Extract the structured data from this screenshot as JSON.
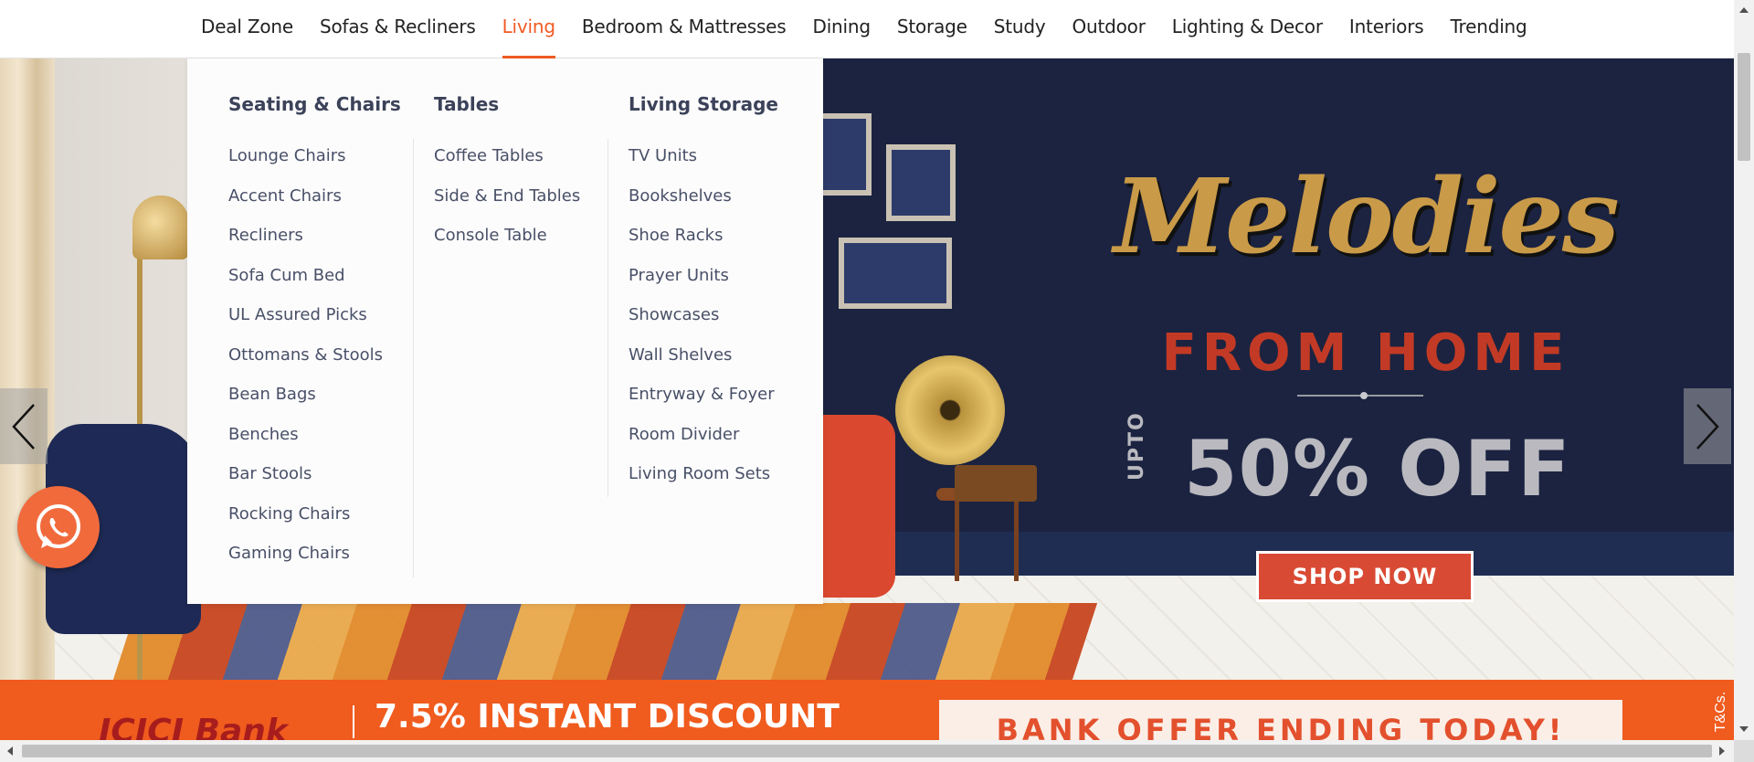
{
  "nav": {
    "items": [
      "Deal Zone",
      "Sofas & Recliners",
      "Living",
      "Bedroom & Mattresses",
      "Dining",
      "Storage",
      "Study",
      "Outdoor",
      "Lighting & Decor",
      "Interiors",
      "Trending"
    ],
    "active": "Living"
  },
  "megamenu": {
    "columns": [
      {
        "heading": "Seating & Chairs",
        "items": [
          "Lounge Chairs",
          "Accent Chairs",
          "Recliners",
          "Sofa Cum Bed",
          "UL Assured Picks",
          "Ottomans & Stools",
          "Bean Bags",
          "Benches",
          "Bar Stools",
          "Rocking Chairs",
          "Gaming Chairs"
        ]
      },
      {
        "heading": "Tables",
        "items": [
          "Coffee Tables",
          "Side & End Tables",
          "Console Table"
        ]
      },
      {
        "heading": "Living Storage",
        "items": [
          "TV Units",
          "Bookshelves",
          "Shoe Racks",
          "Prayer Units",
          "Showcases",
          "Wall Shelves",
          "Entryway & Foyer",
          "Room Divider",
          "Living Room Sets"
        ]
      }
    ]
  },
  "hero": {
    "headline": "Melodies",
    "subheadline": "FROM HOME",
    "offer_prefix": "UPTO",
    "offer": "50% OFF",
    "cta": "SHOP NOW"
  },
  "bank_strip": {
    "bank": "ICICI Bank",
    "discount": "7.5% INSTANT DISCOUNT",
    "message": "BANK OFFER ENDING TODAY!",
    "tc": "T&Cs."
  },
  "icons": {
    "prev": "chevron-left-icon",
    "next": "chevron-right-icon",
    "whatsapp": "whatsapp-icon"
  },
  "colors": {
    "accent": "#f15b26",
    "menu_text": "#485068",
    "menu_heading": "#3b4259",
    "whatsapp_bg": "#f16a3c",
    "cta_bg": "#d94a34",
    "bank_strip_bg": "#f05b1e"
  }
}
